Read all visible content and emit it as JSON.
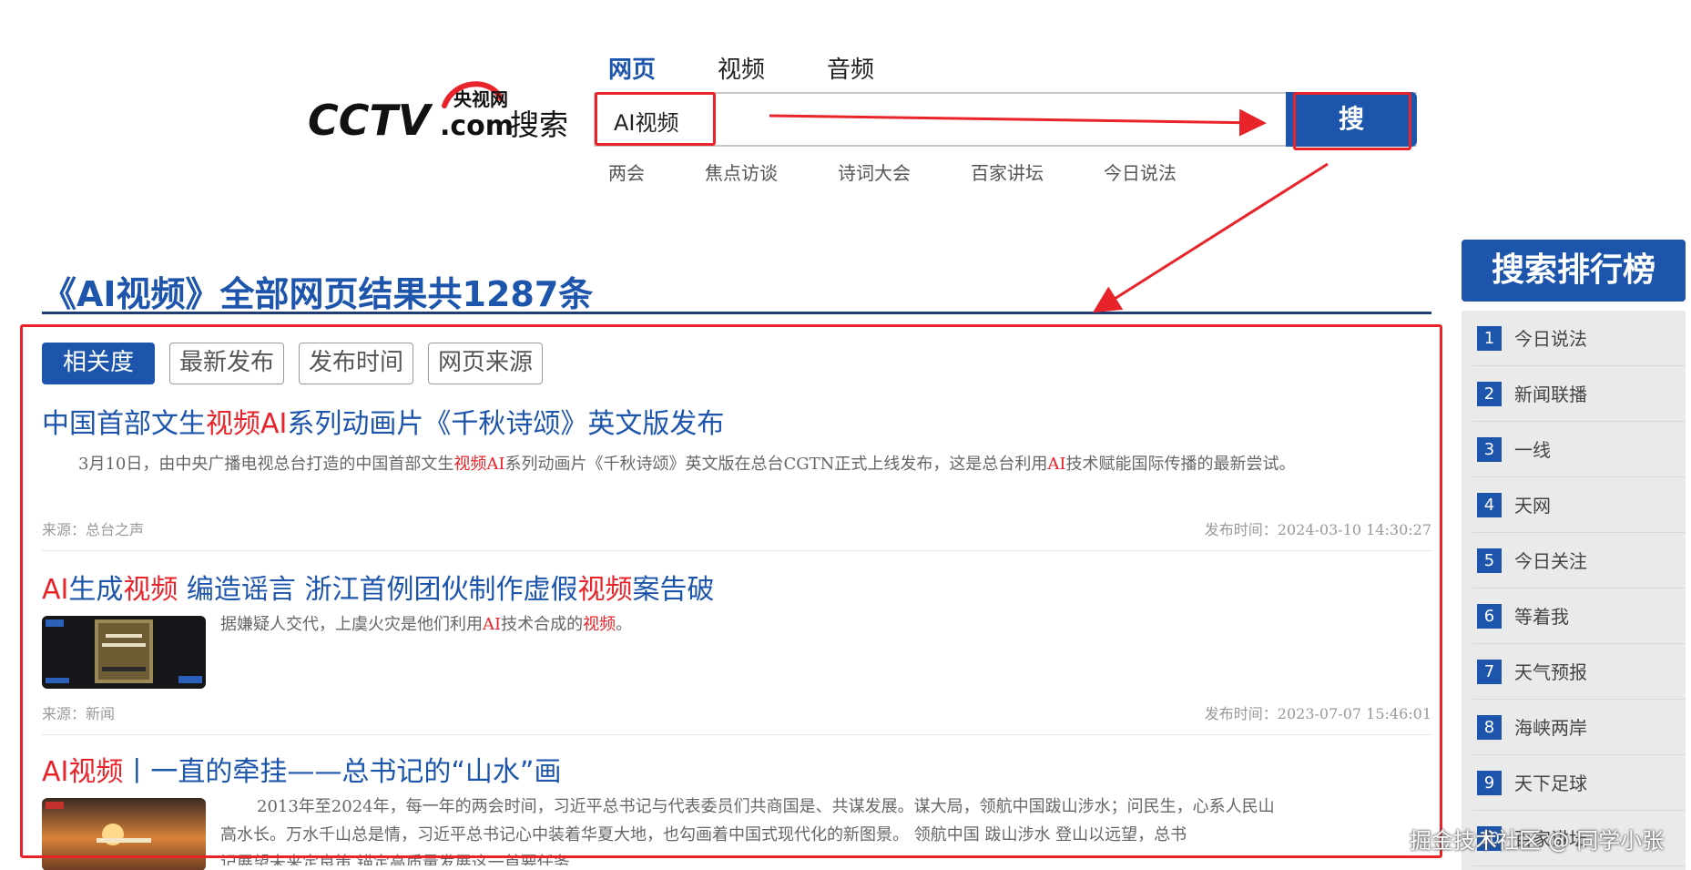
{
  "header": {
    "logo_text": "CCTV.com",
    "logo_cn": "央视网",
    "logo_search": "搜索",
    "tabs": [
      {
        "label": "网页",
        "active": true
      },
      {
        "label": "视频",
        "active": false
      },
      {
        "label": "音频",
        "active": false
      }
    ],
    "search": {
      "value": "AI视频",
      "button_label": "搜 索"
    },
    "hot_words": [
      "两会",
      "焦点访谈",
      "诗词大会",
      "百家讲坛",
      "今日说法"
    ]
  },
  "results": {
    "heading": "《AI视频》全部网页结果共1287条",
    "filters": [
      {
        "label": "相关度",
        "active": true
      },
      {
        "label": "最新发布",
        "active": false
      },
      {
        "label": "发布时间",
        "active": false
      },
      {
        "label": "网页来源",
        "active": false
      }
    ],
    "items": [
      {
        "title": {
          "p1": "中国首部文生",
          "h1": "视频AI",
          "p2": "系列动画片《千秋诗颂》英文版发布"
        },
        "snippet": {
          "p1": "3月10日，由中央广播电视总台打造的中国首部文生",
          "h1": "视频AI",
          "p2": "系列动画片《千秋诗颂》英文版在总台CGTN正式上线发布，这是总台利用",
          "h2": "AI",
          "p3": "技术赋能国际传播的最新尝试。"
        },
        "source": "来源：总台之声",
        "time": "发布时间：2024-03-10 14:30:27"
      },
      {
        "title": {
          "h1": "AI",
          "p1": "生成",
          "h2": "视频",
          "p2": " 编造谣言 浙江首例团伙制作虚假",
          "h3": "视频",
          "p3": "案告破"
        },
        "snippet": {
          "p1": "据嫌疑人交代，上虞火灾是他们利用",
          "h1": "AI",
          "p2": "技术合成的",
          "h2": "视频",
          "p3": "。"
        },
        "source": "来源：新闻",
        "time": "发布时间：2023-07-07 15:46:01"
      },
      {
        "title": {
          "h1": "AI视频",
          "p1": "丨一直的牵挂——总书记的“山水”画"
        },
        "snippet": {
          "line1": "2013年至2024年，每一年的两会时间，习近平总书记与代表委员们共商国是、共谋发展。谋大局，领航中国跋山涉水；问民生，心系人民山",
          "line2": "高水长。万水千山总是情，习近平总书记心中装着华夏大地，也勾画着中国式现代化的新图景。    领航中国 跋山涉水    登山以远望，总书",
          "line3": "记展望未来定良策      锚定高质量发展这一首要任务"
        }
      }
    ]
  },
  "sidebar": {
    "title": "搜索排行榜",
    "items": [
      {
        "rank": "1",
        "label": "今日说法"
      },
      {
        "rank": "2",
        "label": "新闻联播"
      },
      {
        "rank": "3",
        "label": "一线"
      },
      {
        "rank": "4",
        "label": "天网"
      },
      {
        "rank": "5",
        "label": "今日关注"
      },
      {
        "rank": "6",
        "label": "等着我"
      },
      {
        "rank": "7",
        "label": "天气预报"
      },
      {
        "rank": "8",
        "label": "海峡两岸"
      },
      {
        "rank": "9",
        "label": "天下足球"
      },
      {
        "rank": "10",
        "label": "百家讲坛"
      }
    ]
  },
  "watermark": "掘金技术社区 @ 同学小张",
  "colors": {
    "brand_blue": "#1d55ad",
    "highlight_red": "#e8232a",
    "annotation_red": "#e8232a"
  }
}
